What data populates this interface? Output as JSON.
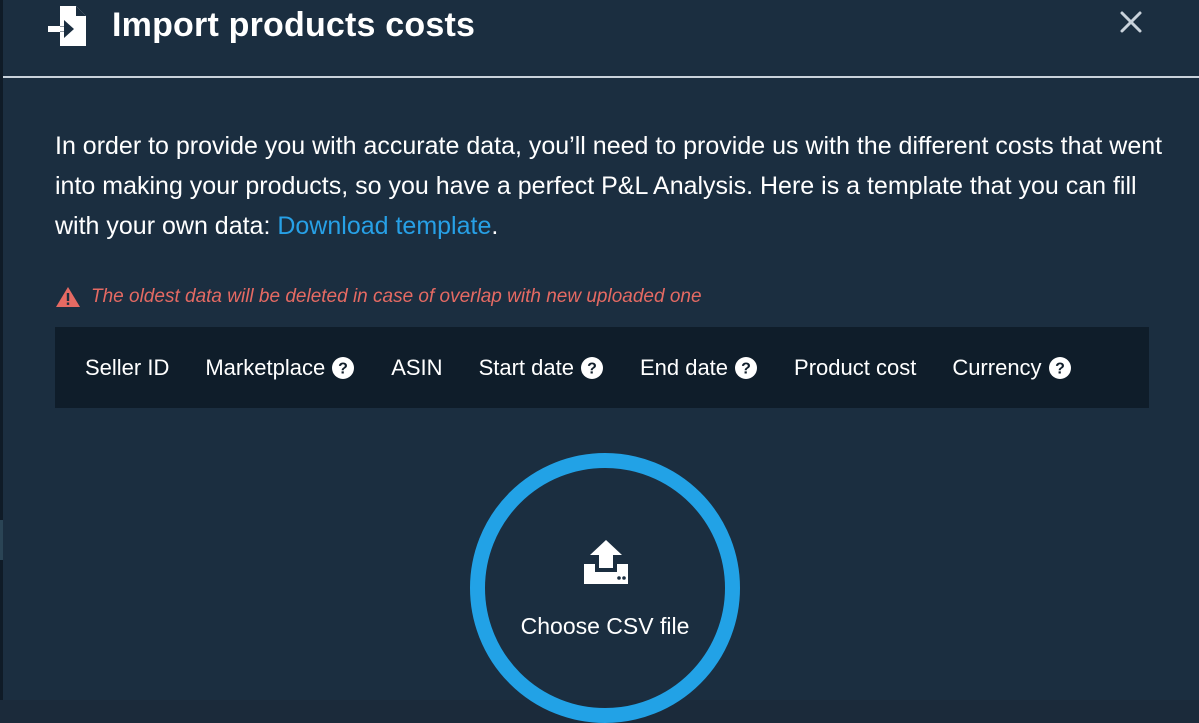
{
  "dialog": {
    "title": "Import products costs",
    "header_icon": "file-import-icon",
    "close_icon": "close-icon"
  },
  "intro": {
    "text": "In order to provide you with accurate data, you’ll need to provide us with the different costs that went into making your products, so you have a perfect P&L Analysis. Here is a template that you can fill with your own data: ",
    "link_label": "Download template",
    "trailing": "."
  },
  "warning": {
    "icon": "warning-triangle-icon",
    "text": "The oldest data will be deleted in case of overlap with new uploaded one"
  },
  "columns": [
    {
      "label": "Seller ID",
      "help": false
    },
    {
      "label": "Marketplace",
      "help": true
    },
    {
      "label": "ASIN",
      "help": false
    },
    {
      "label": "Start date",
      "help": true
    },
    {
      "label": "End date",
      "help": true
    },
    {
      "label": "Product cost",
      "help": false
    },
    {
      "label": "Currency",
      "help": true
    }
  ],
  "upload": {
    "icon": "upload-icon",
    "label": "Choose CSV file"
  },
  "colors": {
    "background": "#1b2e40",
    "accent": "#22a2e6",
    "warning": "#e56a63",
    "table_header_bg": "#0f1d2a"
  }
}
